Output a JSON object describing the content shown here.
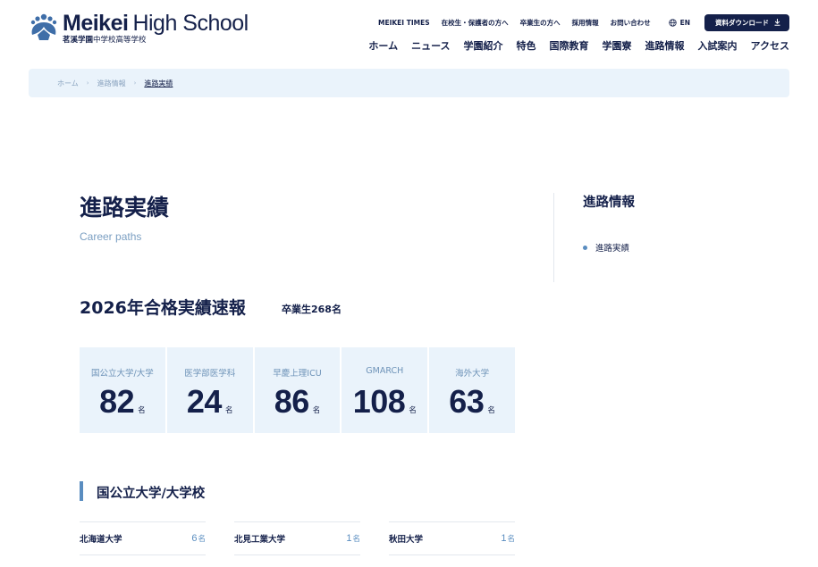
{
  "logo": {
    "brand_bold": "Meikei",
    "brand_light": "High School",
    "sub_bold": "茗溪学園",
    "sub_light": "中学校高等学校"
  },
  "topnav": {
    "links": [
      "MEIKEI TIMES",
      "在校生・保護者の方へ",
      "卒業生の方へ",
      "採用情報",
      "お問い合わせ"
    ],
    "lang": "EN",
    "download_label": "資料ダウンロード"
  },
  "mainnav": {
    "items": [
      "ホーム",
      "ニュース",
      "学園紹介",
      "特色",
      "国際教育",
      "学園寮",
      "進路情報",
      "入試案内",
      "アクセス"
    ]
  },
  "breadcrumb": {
    "items": [
      "ホーム",
      "進路情報",
      "進路実績"
    ]
  },
  "page": {
    "title": "進路実績",
    "subtitle": "Career paths"
  },
  "side": {
    "title": "進路情報",
    "items": [
      "進路実績"
    ]
  },
  "report": {
    "heading": "2026年合格実績速報",
    "graduates": "卒業生268名",
    "stats": [
      {
        "label": "国公立大学/大学",
        "value": "82",
        "unit": "名"
      },
      {
        "label": "医学部医学科",
        "value": "24",
        "unit": "名"
      },
      {
        "label": "早慶上理ICU",
        "value": "86",
        "unit": "名"
      },
      {
        "label": "GMARCH",
        "value": "108",
        "unit": "名"
      },
      {
        "label": "海外大学",
        "value": "63",
        "unit": "名"
      }
    ]
  },
  "national": {
    "heading": "国公立大学/大学校",
    "rows": [
      {
        "name": "北海道大学",
        "count": "6",
        "unit": "名"
      },
      {
        "name": "北見工業大学",
        "count": "1",
        "unit": "名"
      },
      {
        "name": "秋田大学",
        "count": "1",
        "unit": "名"
      }
    ]
  },
  "colors": {
    "navy": "#14204a",
    "accent": "#5a8dc0",
    "pale": "#eaf3fb"
  }
}
